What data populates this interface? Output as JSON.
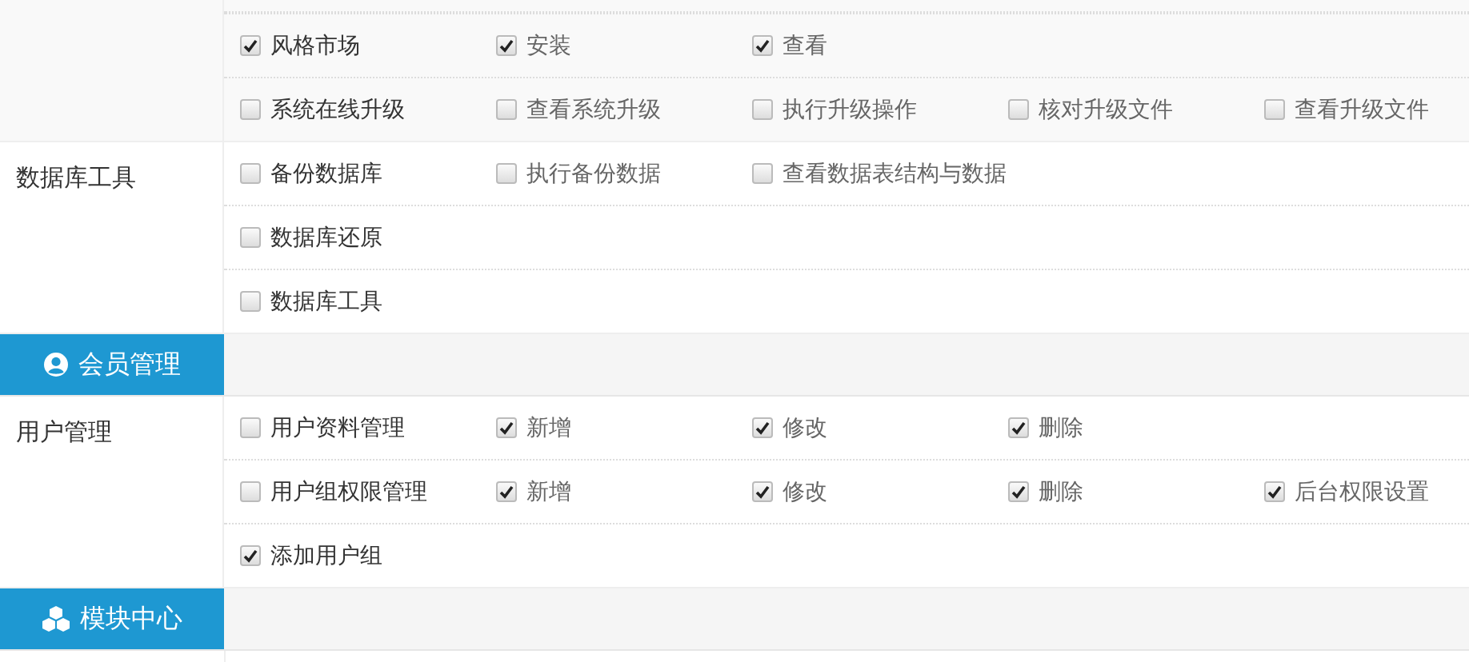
{
  "blocks": [
    {
      "kind": "group",
      "highlighted": true,
      "rows": [
        [
          {
            "label": "风格市场",
            "checked": true
          },
          {
            "label": "安装",
            "checked": true
          },
          {
            "label": "查看",
            "checked": true
          }
        ],
        [
          {
            "label": "系统在线升级",
            "checked": false
          },
          {
            "label": "查看系统升级",
            "checked": false
          },
          {
            "label": "执行升级操作",
            "checked": false
          },
          {
            "label": "核对升级文件",
            "checked": false
          },
          {
            "label": "查看升级文件",
            "checked": false
          }
        ]
      ]
    },
    {
      "kind": "group",
      "highlighted": false,
      "label": "数据库工具",
      "rows": [
        [
          {
            "label": "备份数据库",
            "checked": false
          },
          {
            "label": "执行备份数据",
            "checked": false
          },
          {
            "label": "查看数据表结构与数据",
            "checked": false
          }
        ],
        [
          {
            "label": "数据库还原",
            "checked": false
          }
        ],
        [
          {
            "label": "数据库工具",
            "checked": false
          }
        ]
      ]
    },
    {
      "kind": "header",
      "title": "会员管理"
    },
    {
      "kind": "group",
      "highlighted": false,
      "label": "用户管理",
      "rows": [
        [
          {
            "label": "用户资料管理",
            "checked": false
          },
          {
            "label": "新增",
            "checked": true
          },
          {
            "label": "修改",
            "checked": true
          },
          {
            "label": "删除",
            "checked": true
          }
        ],
        [
          {
            "label": "用户组权限管理",
            "checked": false
          },
          {
            "label": "新增",
            "checked": true
          },
          {
            "label": "修改",
            "checked": true
          },
          {
            "label": "删除",
            "checked": true
          },
          {
            "label": "后台权限设置",
            "checked": true
          }
        ],
        [
          {
            "label": "添加用户组",
            "checked": true
          }
        ]
      ]
    },
    {
      "kind": "header",
      "title": "模块中心"
    }
  ]
}
